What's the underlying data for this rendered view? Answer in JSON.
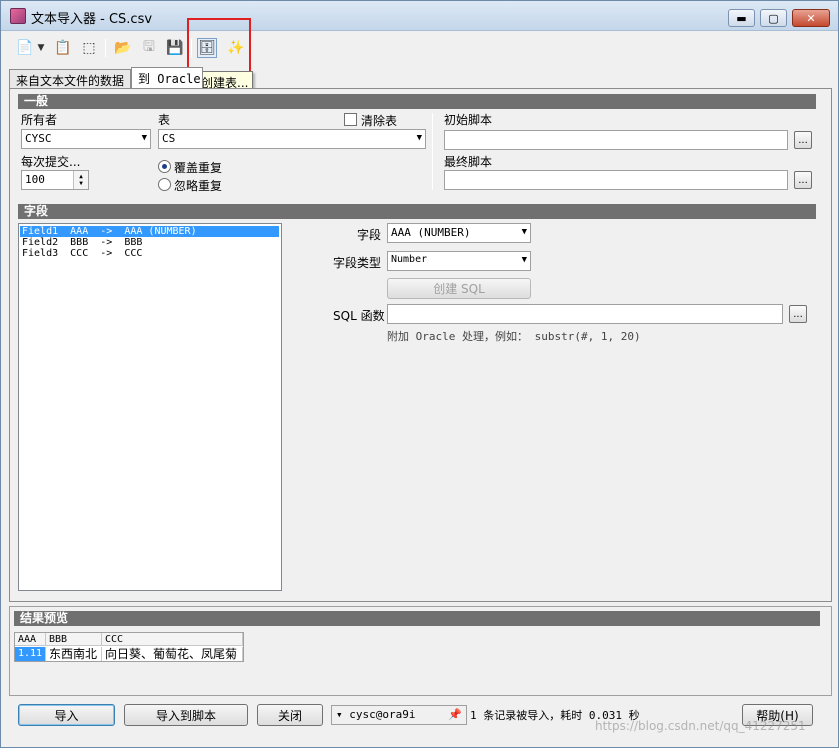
{
  "window": {
    "title": "文本导入器 - CS.csv",
    "min_label": "▬",
    "max_label": "▢",
    "close_label": "✕"
  },
  "tooltip": "创建表...",
  "tabs": [
    {
      "label": "来自文本文件的数据"
    },
    {
      "label": "到 Oracle"
    }
  ],
  "general": {
    "header": "一般",
    "owner_label": "所有者",
    "owner_value": "CYSC",
    "table_label": "表",
    "table_value": "CS",
    "clear_label": "清除表",
    "commit_label": "每次提交...",
    "commit_value": "100",
    "radio_overwrite": "覆盖重复",
    "radio_ignore": "忽略重复",
    "init_label": "初始脚本",
    "final_label": "最终脚本",
    "ellipsis": "..."
  },
  "fields": {
    "header": "字段",
    "list": [
      "Field1  AAA  ->  AAA (NUMBER)",
      "Field2  BBB  ->  BBB",
      "Field3  CCC  ->  CCC"
    ],
    "field_label": "字段",
    "field_value": "AAA (NUMBER)",
    "type_label": "字段类型",
    "type_value": "Number",
    "create_sql": "创建 SQL",
    "sql_func_label": "SQL 函数",
    "hint": "附加 Oracle 处理，例如： substr(#, 1, 20)"
  },
  "preview": {
    "header": "结果预览",
    "columns": [
      "AAA",
      "BBB",
      "CCC"
    ],
    "row": [
      "1.11",
      "东西南北",
      "向日葵、葡萄花、凤尾菊"
    ]
  },
  "bottom": {
    "import": "导入",
    "import_script": "导入到脚本",
    "close": "关闭",
    "connection": "cysc@ora9i",
    "status": "1 条记录被导入，耗时 0.031 秒",
    "help": "帮助(H)"
  },
  "watermark": "https://blog.csdn.net/qq_41227251"
}
